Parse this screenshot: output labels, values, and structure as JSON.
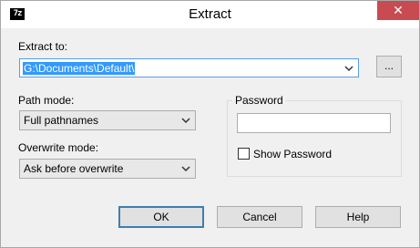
{
  "window": {
    "title": "Extract",
    "icon_text": "7z",
    "close_glyph": "✕"
  },
  "extract_to": {
    "label": "Extract to:",
    "value": "G:\\Documents\\Default\\",
    "browse_label": "..."
  },
  "path_mode": {
    "label": "Path mode:",
    "value": "Full pathnames"
  },
  "overwrite_mode": {
    "label": "Overwrite mode:",
    "value": "Ask before overwrite"
  },
  "password": {
    "group_label": "Password",
    "value": "",
    "show_label": "Show Password",
    "show_checked": false
  },
  "buttons": {
    "ok": "OK",
    "cancel": "Cancel",
    "help": "Help"
  },
  "colors": {
    "close_button": "#c74b50",
    "selection": "#3399ff",
    "default_button_border": "#3c7fb1",
    "dialog_background": "#f0f0f0"
  }
}
